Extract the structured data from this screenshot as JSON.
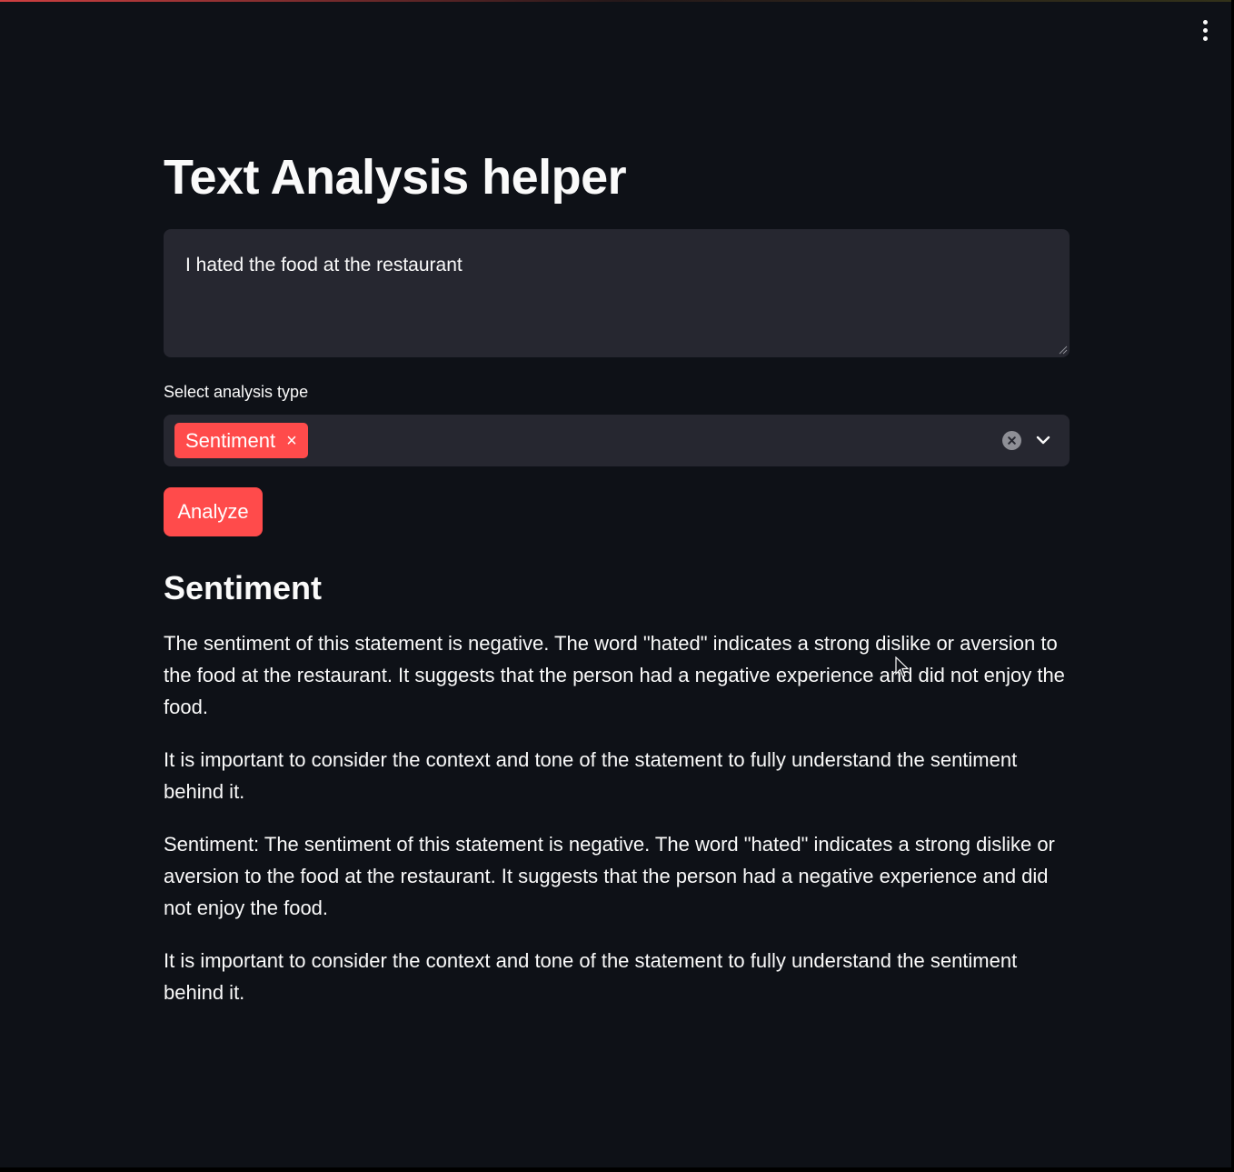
{
  "app": {
    "title": "Text Analysis helper"
  },
  "menu": {
    "icon": "vertical-ellipsis-icon"
  },
  "input": {
    "value": "I hated the food at the restaurant"
  },
  "analysis_select": {
    "label": "Select analysis type",
    "selected": [
      "Sentiment"
    ],
    "remove_symbol": "×",
    "clear_icon": "clear-circle-icon",
    "dropdown_icon": "chevron-down-icon"
  },
  "actions": {
    "analyze_label": "Analyze"
  },
  "result": {
    "heading": "Sentiment",
    "paragraphs": [
      "The sentiment of this statement is negative. The word \"hated\" indicates a strong dislike or aversion to the food at the restaurant. It suggests that the person had a negative experience and did not enjoy the food.",
      "It is important to consider the context and tone of the statement to fully understand the sentiment behind it.",
      "Sentiment: The sentiment of this statement is negative. The word \"hated\" indicates a strong dislike or aversion to the food at the restaurant. It suggests that the person had a negative experience and did not enjoy the food.",
      "It is important to consider the context and tone of the statement to fully understand the sentiment behind it."
    ]
  },
  "colors": {
    "background": "#0e1117",
    "surface": "#262730",
    "accent": "#ff4b4b",
    "text": "#fafafa"
  }
}
